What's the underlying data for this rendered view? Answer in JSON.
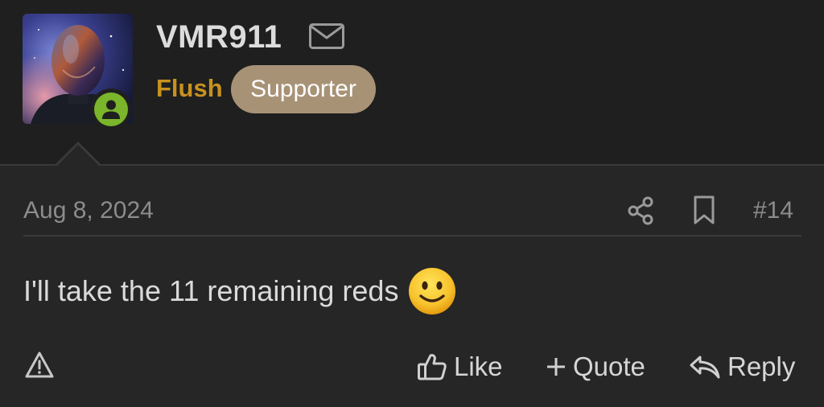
{
  "user": {
    "username": "VMR911",
    "title": "Flush",
    "banner": "Supporter",
    "online": true
  },
  "post": {
    "date": "Aug 8, 2024",
    "number": "#14",
    "message": "I'll take the 11 remaining reds"
  },
  "actions": {
    "like": "Like",
    "quote": "Quote",
    "reply": "Reply"
  },
  "icons": {
    "mail": "envelope-icon",
    "share": "share-icon",
    "bookmark": "bookmark-icon",
    "report": "warning-triangle-icon",
    "like": "thumbs-up-icon",
    "quote": "plus-icon",
    "reply": "reply-arrow-icon",
    "emoji": "slightly-smiling-face"
  },
  "colors": {
    "background": "#1f1f1f",
    "post_background": "#262626",
    "user_title": "#c8921e",
    "banner_background": "#a89276",
    "online": "#7ab52b"
  }
}
